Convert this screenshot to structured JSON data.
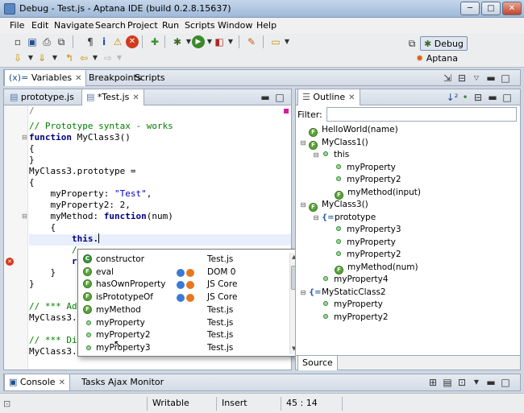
{
  "window": {
    "title": "Debug - Test.js - Aptana IDE (build 0.2.8.15637)",
    "minimize": "─",
    "maximize": "□",
    "close": "✕"
  },
  "menu": [
    "File",
    "Edit",
    "Navigate",
    "Search",
    "Project",
    "Run",
    "Scripts",
    "Window",
    "Help"
  ],
  "perspectives": {
    "debug": "Debug",
    "aptana": "Aptana"
  },
  "top_tabs": {
    "variables": "Variables",
    "breakpoints": "Breakpoints",
    "scripts": "Scripts"
  },
  "editor": {
    "tabs": [
      {
        "label": "prototype.js"
      },
      {
        "label": "*Test.js"
      }
    ],
    "lines": [
      {
        "t": "// Prototype syntax - works",
        "kind": "comment"
      },
      {
        "pre": "",
        "kw": "function",
        "post": " MyClass3()",
        "kind": "kwline"
      },
      {
        "t": "{",
        "kind": "plain"
      },
      {
        "t": "}",
        "kind": "plain"
      },
      {
        "t": "MyClass3.prototype =",
        "kind": "plain"
      },
      {
        "t": "{",
        "kind": "plain"
      },
      {
        "pre": "    myProperty: ",
        "str": "\"Test\"",
        "post": ",",
        "kind": "strline"
      },
      {
        "t": "    myProperty2: 2,",
        "kind": "plain"
      },
      {
        "pre": "    myMethod: ",
        "kw": "function",
        "post": "(num)",
        "kind": "kwline"
      },
      {
        "t": "    {",
        "kind": "plain"
      },
      {
        "t": "        this.",
        "kind": "current"
      },
      {
        "t": "        /",
        "kind": "comment"
      },
      {
        "t": "        r",
        "kind": "kwpartial"
      },
      {
        "t": "    }",
        "kind": "plain"
      },
      {
        "t": "}",
        "kind": "plain"
      },
      {
        "t": "",
        "kind": "plain"
      },
      {
        "t": "// *** Ad",
        "kind": "comment"
      },
      {
        "t": "MyClass3.",
        "kind": "plain"
      },
      {
        "t": "",
        "kind": "plain"
      },
      {
        "t": "// *** Di",
        "kind": "comment"
      },
      {
        "t": "MyClass3.",
        "kind": "plain"
      }
    ]
  },
  "autocomplete": [
    {
      "icon": "C",
      "name": "constructor",
      "ie": false,
      "source": "Test.js"
    },
    {
      "icon": "F",
      "name": "eval",
      "ie": true,
      "source": "DOM 0"
    },
    {
      "icon": "F",
      "name": "hasOwnProperty",
      "ie": true,
      "source": "JS Core"
    },
    {
      "icon": "F",
      "name": "isPrototypeOf",
      "ie": true,
      "source": "JS Core"
    },
    {
      "icon": "F",
      "name": "myMethod",
      "ie": false,
      "source": "Test.js"
    },
    {
      "icon": "dot",
      "name": "myProperty",
      "ie": false,
      "source": "Test.js"
    },
    {
      "icon": "dot",
      "name": "myProperty2",
      "ie": false,
      "source": "Test.js"
    },
    {
      "icon": "dot",
      "name": "myProperty3",
      "ie": false,
      "source": "Test.js"
    }
  ],
  "outline": {
    "tab": "Outline",
    "filter_label": "Filter:",
    "filter_value": "",
    "source_tab": "Source",
    "items": [
      {
        "depth": 0,
        "twist": "",
        "icon": "F",
        "label": "HelloWorld(name)"
      },
      {
        "depth": 0,
        "twist": "⊟",
        "icon": "F",
        "label": "MyClass1()"
      },
      {
        "depth": 1,
        "twist": "⊟",
        "icon": "dot",
        "label": "this"
      },
      {
        "depth": 2,
        "twist": "",
        "icon": "dot",
        "label": "myProperty"
      },
      {
        "depth": 2,
        "twist": "",
        "icon": "dot",
        "label": "myProperty2"
      },
      {
        "depth": 2,
        "twist": "",
        "icon": "F",
        "label": "myMethod(input)"
      },
      {
        "depth": 0,
        "twist": "⊟",
        "icon": "F",
        "label": "MyClass3()"
      },
      {
        "depth": 1,
        "twist": "⊟",
        "icon": "brace",
        "label": "prototype"
      },
      {
        "depth": 2,
        "twist": "",
        "icon": "dot",
        "label": "myProperty3"
      },
      {
        "depth": 2,
        "twist": "",
        "icon": "dot",
        "label": "myProperty"
      },
      {
        "depth": 2,
        "twist": "",
        "icon": "dot",
        "label": "myProperty2"
      },
      {
        "depth": 2,
        "twist": "",
        "icon": "F",
        "label": "myMethod(num)"
      },
      {
        "depth": 1,
        "twist": "",
        "icon": "dot",
        "label": "myProperty4"
      },
      {
        "depth": 0,
        "twist": "⊟",
        "icon": "brace",
        "label": "MyStaticClass2"
      },
      {
        "depth": 1,
        "twist": "",
        "icon": "dot",
        "label": "myProperty"
      },
      {
        "depth": 1,
        "twist": "",
        "icon": "dot",
        "label": "myProperty2"
      }
    ]
  },
  "bottom_tabs": {
    "console": "Console",
    "tasks": "Tasks",
    "ajax": "Ajax Monitor"
  },
  "status": {
    "writable": "Writable",
    "mode": "Insert",
    "position": "45 : 14"
  },
  "colors": {
    "keyword": "#000080",
    "comment": "#008000",
    "string": "#0000c0",
    "accent": "#5ba43a"
  }
}
